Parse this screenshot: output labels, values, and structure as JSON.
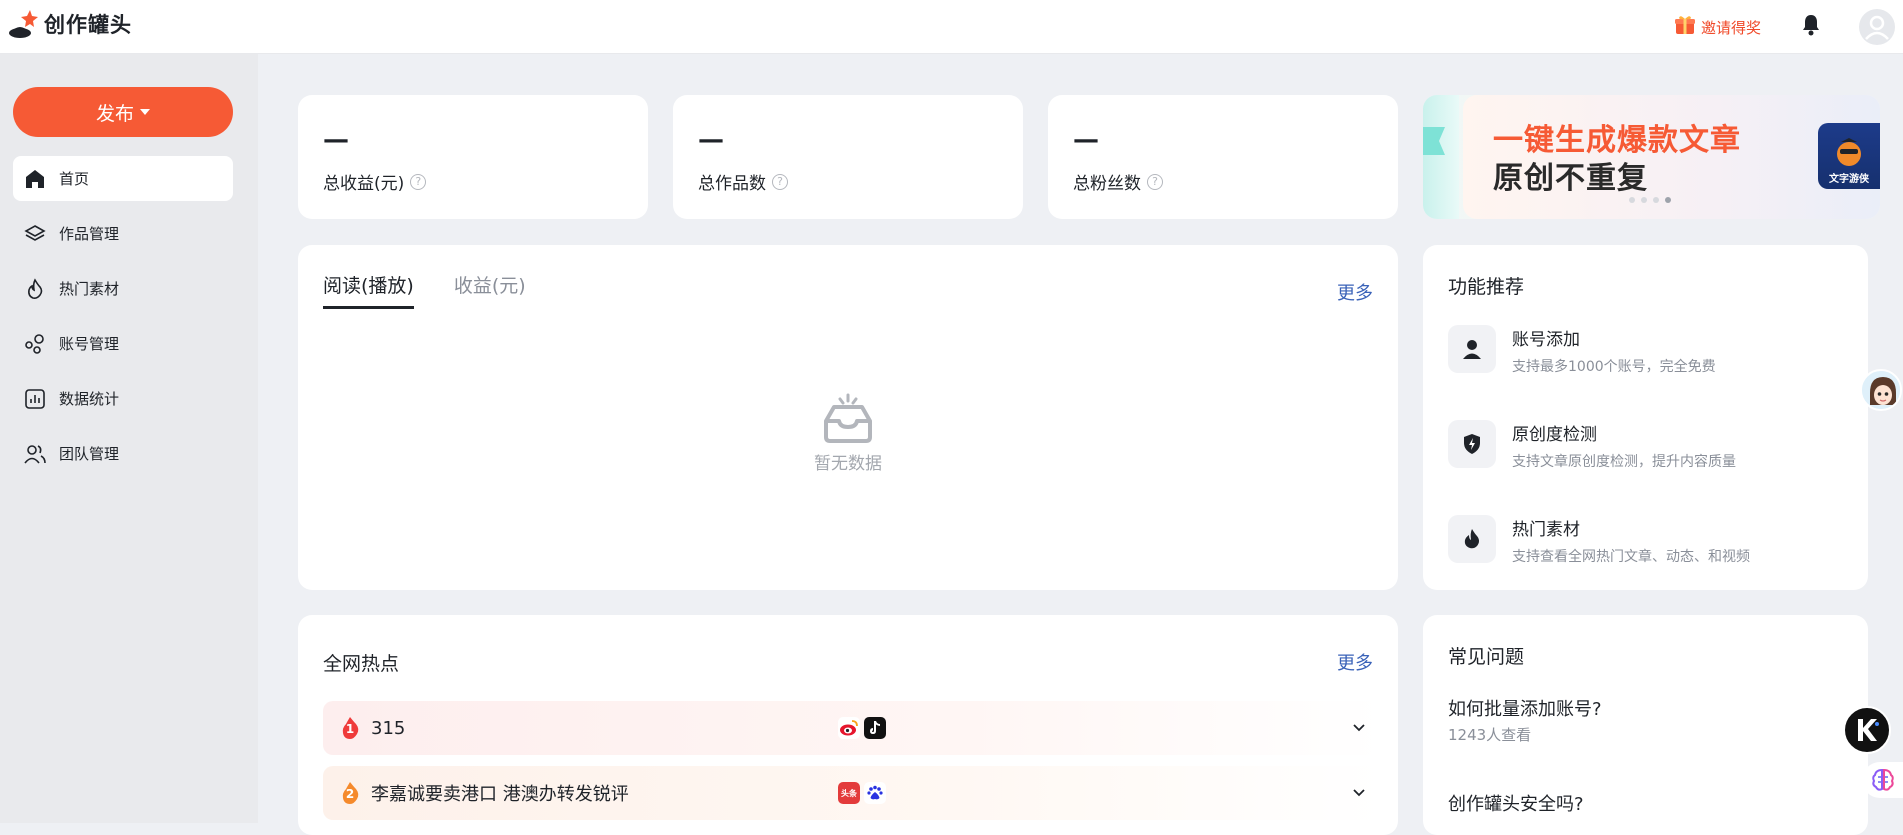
{
  "app": {
    "name": "创作罐头"
  },
  "header": {
    "invite_label": "邀请得奖"
  },
  "sidebar": {
    "publish_label": "发布",
    "items": [
      {
        "label": "首页",
        "icon": "home-icon",
        "active": true
      },
      {
        "label": "作品管理",
        "icon": "layers-icon",
        "active": false
      },
      {
        "label": "热门素材",
        "icon": "flame-icon",
        "active": false
      },
      {
        "label": "账号管理",
        "icon": "accounts-icon",
        "active": false
      },
      {
        "label": "数据统计",
        "icon": "chart-icon",
        "active": false
      },
      {
        "label": "团队管理",
        "icon": "team-icon",
        "active": false
      }
    ]
  },
  "stats": [
    {
      "value": "—",
      "label": "总收益(元)"
    },
    {
      "value": "—",
      "label": "总作品数"
    },
    {
      "value": "—",
      "label": "总粉丝数"
    }
  ],
  "banner": {
    "title": "一键生成爆款文章",
    "subtitle": "原创不重复",
    "badge": "文字游侠",
    "dots": 4,
    "active_dot": 4
  },
  "reading": {
    "tabs": [
      "阅读(播放)",
      "收益(元)"
    ],
    "active_tab": 0,
    "more_label": "更多",
    "empty_label": "暂无数据"
  },
  "features": {
    "title": "功能推荐",
    "items": [
      {
        "title": "账号添加",
        "desc": "支持最多1000个账号，完全免费",
        "icon": "user-icon"
      },
      {
        "title": "原创度检测",
        "desc": "支持文章原创度检测，提升内容质量",
        "icon": "shield-icon"
      },
      {
        "title": "热门素材",
        "desc": "支持查看全网热门文章、动态、和视频",
        "icon": "flame-icon"
      }
    ]
  },
  "hot": {
    "title": "全网热点",
    "more_label": "更多",
    "items": [
      {
        "rank": "1",
        "title": "315",
        "sources": [
          "weibo-icon",
          "douyin-icon"
        ]
      },
      {
        "rank": "2",
        "title": "李嘉诚要卖港口 港澳办转发锐评",
        "sources": [
          "toutiao-icon",
          "baidu-icon"
        ]
      }
    ],
    "source_labels": {
      "toutiao": "头条"
    }
  },
  "faq": {
    "title": "常见问题",
    "items": [
      {
        "question": "如何批量添加账号?",
        "views": "1243人查看"
      },
      {
        "question": "创作罐头安全吗?",
        "views": ""
      }
    ]
  },
  "colors": {
    "accent": "#f65a35",
    "link": "#3a62b8",
    "sidebar_bg": "#e9eaed",
    "page_bg": "#eef0f4"
  }
}
